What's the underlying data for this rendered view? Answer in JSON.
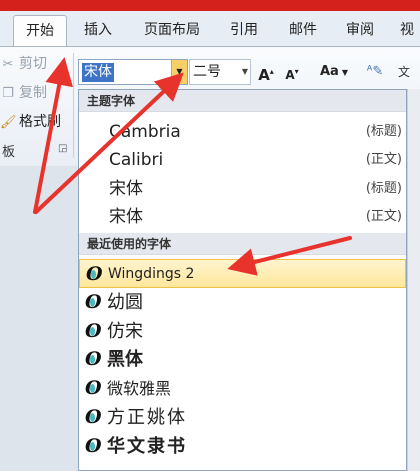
{
  "ribbon_tabs": [
    "开始",
    "插入",
    "页面布局",
    "引用",
    "邮件",
    "审阅",
    "视"
  ],
  "clipboard": {
    "cut_label": "剪切",
    "copy_label": "复制",
    "format_painter_label": "格式刷",
    "group_label": "板"
  },
  "font_box": {
    "value": "宋体"
  },
  "size_box": {
    "value": "二号"
  },
  "toolbar": {
    "case_label": "Aa"
  },
  "dropdown": {
    "theme_header": "主题字体",
    "theme_fonts": [
      {
        "name": "Cambria",
        "role": "(标题)"
      },
      {
        "name": "Calibri",
        "role": "(正文)"
      },
      {
        "name": "宋体",
        "role": "(标题)"
      },
      {
        "name": "宋体",
        "role": "(正文)"
      }
    ],
    "recent_header": "最近使用的字体",
    "recent_fonts": [
      "Wingdings 2",
      "幼圆",
      "仿宋",
      "黑体",
      "微软雅黑",
      "方正姚体",
      "华文隶书"
    ]
  },
  "colors": {
    "title_bar": "#d4211c",
    "highlight": "#ffe79b",
    "selection": "#3d74c8",
    "annotation_arrow": "#e8322c"
  },
  "icons": [
    "scissors-icon",
    "copy-icon",
    "format-painter-icon",
    "dialog-launcher-icon",
    "grow-font-icon",
    "shrink-font-icon",
    "change-case-icon",
    "clear-format-icon",
    "font-type-icon"
  ]
}
